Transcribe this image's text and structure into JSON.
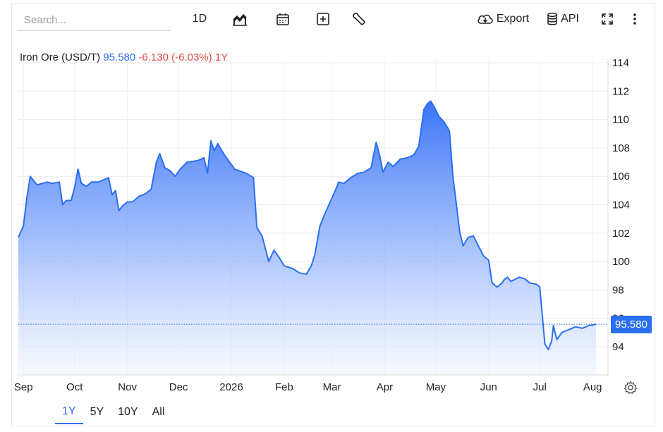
{
  "toolbar": {
    "search_placeholder": "Search...",
    "interval_label": "1D",
    "export_label": "Export",
    "api_label": "API",
    "icons": [
      "chart-type-icon",
      "calendar-icon",
      "add-compare-icon",
      "wrench-icon",
      "cloud-download-icon",
      "database-icon",
      "fullscreen-icon",
      "more-vertical-icon"
    ]
  },
  "legend": {
    "name": "Iron Ore (USD/T)",
    "price": "95.580",
    "change": "-6.130 (-6.03%)",
    "period": "1Y"
  },
  "price_tag": "95.580",
  "range_buttons": [
    "1Y",
    "5Y",
    "10Y",
    "All"
  ],
  "active_range": "1Y",
  "colors": {
    "line": "#2a6ff2",
    "down": "#e24c4c",
    "fill_top": "#2f6cf6"
  },
  "chart_data": {
    "type": "area",
    "x_tick_labels": [
      "Sep",
      "Oct",
      "Nov",
      "Dec",
      "2026",
      "Feb",
      "Mar",
      "Apr",
      "May",
      "Jun",
      "Jul",
      "Aug"
    ],
    "y_ticks": [
      94,
      96,
      98,
      100,
      102,
      104,
      106,
      108,
      110,
      112,
      114
    ],
    "ylim": [
      93,
      115
    ],
    "last_value": 95.58,
    "grid": true,
    "series": [
      {
        "points": [
          [
            "2025-08-29",
            101.7
          ],
          [
            "2025-09-01",
            102.5
          ],
          [
            "2025-09-03",
            104.5
          ],
          [
            "2025-09-05",
            106.0
          ],
          [
            "2025-09-07",
            105.7
          ],
          [
            "2025-09-09",
            105.4
          ],
          [
            "2025-09-12",
            105.5
          ],
          [
            "2025-09-15",
            105.6
          ],
          [
            "2025-09-18",
            105.5
          ],
          [
            "2025-09-22",
            105.6
          ],
          [
            "2025-09-24",
            104.0
          ],
          [
            "2025-09-26",
            104.3
          ],
          [
            "2025-09-29",
            104.3
          ],
          [
            "2025-10-01",
            105.2
          ],
          [
            "2025-10-03",
            106.5
          ],
          [
            "2025-10-05",
            105.5
          ],
          [
            "2025-10-08",
            105.3
          ],
          [
            "2025-10-11",
            105.6
          ],
          [
            "2025-10-15",
            105.6
          ],
          [
            "2025-10-19",
            105.8
          ],
          [
            "2025-10-21",
            105.9
          ],
          [
            "2025-10-23",
            104.7
          ],
          [
            "2025-10-25",
            105.0
          ],
          [
            "2025-10-27",
            103.6
          ],
          [
            "2025-10-29",
            103.9
          ],
          [
            "2025-11-01",
            104.2
          ],
          [
            "2025-11-04",
            104.2
          ],
          [
            "2025-11-08",
            104.6
          ],
          [
            "2025-11-12",
            104.8
          ],
          [
            "2025-11-15",
            105.1
          ],
          [
            "2025-11-18",
            107.0
          ],
          [
            "2025-11-20",
            107.6
          ],
          [
            "2025-11-23",
            106.6
          ],
          [
            "2025-11-26",
            106.4
          ],
          [
            "2025-11-29",
            106.0
          ],
          [
            "2025-12-02",
            106.5
          ],
          [
            "2025-12-06",
            107.0
          ],
          [
            "2025-12-12",
            107.1
          ],
          [
            "2025-12-16",
            107.3
          ],
          [
            "2025-12-18",
            106.2
          ],
          [
            "2025-12-20",
            108.5
          ],
          [
            "2025-12-22",
            107.8
          ],
          [
            "2025-12-24",
            108.3
          ],
          [
            "2025-12-28",
            107.5
          ],
          [
            "2026-01-03",
            106.5
          ],
          [
            "2026-01-10",
            106.2
          ],
          [
            "2026-01-14",
            105.9
          ],
          [
            "2026-01-16",
            102.4
          ],
          [
            "2026-01-19",
            101.8
          ],
          [
            "2026-01-23",
            100.0
          ],
          [
            "2026-01-26",
            100.8
          ],
          [
            "2026-01-29",
            100.3
          ],
          [
            "2026-02-01",
            99.7
          ],
          [
            "2026-02-06",
            99.5
          ],
          [
            "2026-02-10",
            99.2
          ],
          [
            "2026-02-14",
            99.1
          ],
          [
            "2026-02-17",
            99.7
          ],
          [
            "2026-02-19",
            100.5
          ],
          [
            "2026-02-22",
            102.5
          ],
          [
            "2026-02-25",
            103.4
          ],
          [
            "2026-02-28",
            104.2
          ],
          [
            "2026-03-03",
            105.0
          ],
          [
            "2026-03-05",
            105.6
          ],
          [
            "2026-03-08",
            105.5
          ],
          [
            "2026-03-12",
            105.9
          ],
          [
            "2026-03-16",
            106.2
          ],
          [
            "2026-03-20",
            106.3
          ],
          [
            "2026-03-24",
            106.6
          ],
          [
            "2026-03-27",
            108.4
          ],
          [
            "2026-03-29",
            107.5
          ],
          [
            "2026-03-31",
            106.3
          ],
          [
            "2026-04-03",
            107.0
          ],
          [
            "2026-04-06",
            106.7
          ],
          [
            "2026-04-10",
            107.2
          ],
          [
            "2026-04-14",
            107.3
          ],
          [
            "2026-04-18",
            107.5
          ],
          [
            "2026-04-21",
            108.1
          ],
          [
            "2026-04-24",
            110.7
          ],
          [
            "2026-04-26",
            111.1
          ],
          [
            "2026-04-28",
            111.3
          ],
          [
            "2026-04-30",
            110.9
          ],
          [
            "2026-05-03",
            110.2
          ],
          [
            "2026-05-06",
            109.8
          ],
          [
            "2026-05-09",
            109.2
          ],
          [
            "2026-05-11",
            106.0
          ],
          [
            "2026-05-13",
            104.1
          ],
          [
            "2026-05-15",
            102.1
          ],
          [
            "2026-05-17",
            101.1
          ],
          [
            "2026-05-20",
            101.7
          ],
          [
            "2026-05-23",
            101.8
          ],
          [
            "2026-05-26",
            101.1
          ],
          [
            "2026-05-29",
            100.4
          ],
          [
            "2026-06-01",
            100.1
          ],
          [
            "2026-06-03",
            98.5
          ],
          [
            "2026-06-06",
            98.2
          ],
          [
            "2026-06-09",
            98.5
          ],
          [
            "2026-06-10",
            98.7
          ],
          [
            "2026-06-12",
            98.9
          ],
          [
            "2026-06-14",
            98.6
          ],
          [
            "2026-06-19",
            98.9
          ],
          [
            "2026-06-22",
            98.8
          ],
          [
            "2026-06-25",
            98.5
          ],
          [
            "2026-06-29",
            98.4
          ],
          [
            "2026-07-01",
            98.2
          ],
          [
            "2026-07-04",
            94.2
          ],
          [
            "2026-07-06",
            93.8
          ],
          [
            "2026-07-08",
            94.4
          ],
          [
            "2026-07-09",
            95.5
          ],
          [
            "2026-07-11",
            94.5
          ],
          [
            "2026-07-14",
            95.0
          ],
          [
            "2026-07-18",
            95.2
          ],
          [
            "2026-07-22",
            95.4
          ],
          [
            "2026-07-26",
            95.3
          ],
          [
            "2026-07-30",
            95.5
          ],
          [
            "2026-08-03",
            95.58
          ]
        ]
      }
    ]
  }
}
